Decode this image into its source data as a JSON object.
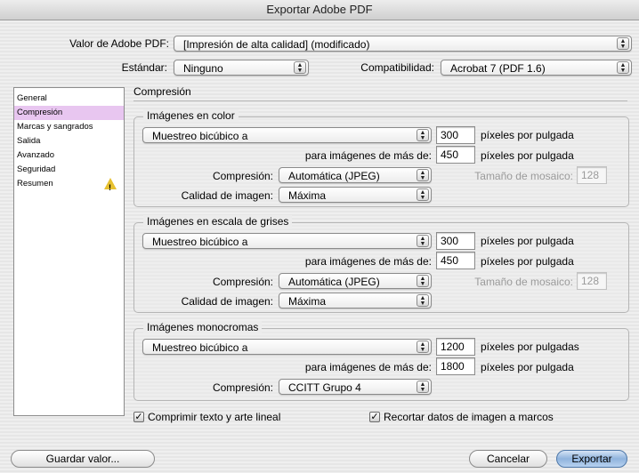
{
  "window": {
    "title": "Exportar Adobe PDF"
  },
  "preset": {
    "label": "Valor de Adobe PDF:",
    "value": "[Impresión de alta calidad] (modificado)"
  },
  "standard": {
    "label": "Estándar:",
    "value": "Ninguno"
  },
  "compat": {
    "label": "Compatibilidad:",
    "value": "Acrobat 7 (PDF 1.6)"
  },
  "sidebar": {
    "items": [
      {
        "label": "General"
      },
      {
        "label": "Compresión"
      },
      {
        "label": "Marcas y sangrados"
      },
      {
        "label": "Salida"
      },
      {
        "label": "Avanzado"
      },
      {
        "label": "Seguridad"
      },
      {
        "label": "Resumen",
        "warning": true
      }
    ]
  },
  "section_title": "Compresión",
  "color": {
    "title": "Imágenes en color",
    "method": "Muestreo bicúbico a",
    "ppi": "300",
    "ppi_unit": "píxeles por pulgada",
    "above_label": "para imágenes de más de:",
    "above": "450",
    "above_unit": "píxeles por pulgada",
    "compression_label": "Compresión:",
    "compression": "Automática (JPEG)",
    "tile_label": "Tamaño de mosaico:",
    "tile": "128",
    "quality_label": "Calidad de imagen:",
    "quality": "Máxima"
  },
  "gray": {
    "title": "Imágenes en escala de grises",
    "method": "Muestreo bicúbico a",
    "ppi": "300",
    "ppi_unit": "píxeles por pulgada",
    "above_label": "para imágenes de más de:",
    "above": "450",
    "above_unit": "píxeles por pulgada",
    "compression_label": "Compresión:",
    "compression": "Automática (JPEG)",
    "tile_label": "Tamaño de mosaico:",
    "tile": "128",
    "quality_label": "Calidad de imagen:",
    "quality": "Máxima"
  },
  "mono": {
    "title": "Imágenes monocromas",
    "method": "Muestreo bicúbico a",
    "ppi": "1200",
    "ppi_unit": "píxeles por pulgadas",
    "above_label": "para imágenes de más de:",
    "above": "1800",
    "above_unit": "píxeles por pulgada",
    "compression_label": "Compresión:",
    "compression": "CCITT Grupo 4"
  },
  "options": {
    "compress_text": "Comprimir texto y arte lineal",
    "crop_images": "Recortar datos de imagen a marcos"
  },
  "buttons": {
    "save": "Guardar valor...",
    "cancel": "Cancelar",
    "export": "Exportar"
  },
  "icons": {
    "popup_arrows": "updown-arrows-icon",
    "warning": "warning-triangle-icon",
    "check": "checkmark-icon"
  }
}
